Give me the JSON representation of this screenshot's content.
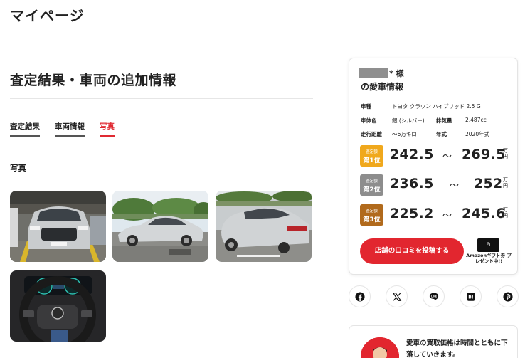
{
  "page_title": "マイページ",
  "section_title": "査定結果・車両の追加情報",
  "tabs": [
    {
      "label": "査定結果",
      "active": false
    },
    {
      "label": "車両情報",
      "active": false
    },
    {
      "label": "写真",
      "active": true
    }
  ],
  "photos_heading": "写真",
  "photos": [
    {
      "alt": "Front view of silver sedan"
    },
    {
      "alt": "Side view of silver sedan"
    },
    {
      "alt": "Rear view of silver sedan"
    },
    {
      "alt": "Steering wheel and dashboard"
    }
  ],
  "car_card": {
    "owner_suffix": "* 様",
    "heading": "の愛車情報",
    "specs": {
      "model_label": "車種",
      "model_value": "トヨタ クラウン ハイブリッド 2.5 G",
      "color_label": "車体色",
      "color_value": "銀 (シルバー)",
      "displacement_label": "排気量",
      "displacement_value": "2,487cc",
      "mileage_label": "走行距離",
      "mileage_value": "～6万キロ",
      "year_label": "年式",
      "year_value": "2020年式"
    },
    "prices": [
      {
        "badge_sub": "査定額",
        "badge_main": "第1位",
        "low": "242.5",
        "high": "269.5",
        "tilde": "～",
        "unit": "万円",
        "color": "#f0a81c"
      },
      {
        "badge_sub": "査定額",
        "badge_main": "第2位",
        "low": "236.5",
        "high": "252",
        "tilde": "～",
        "unit": "万円",
        "color": "#8d8d8d"
      },
      {
        "badge_sub": "査定額",
        "badge_main": "第3位",
        "low": "225.2",
        "high": "245.6",
        "tilde": "～",
        "unit": "万円",
        "color": "#b16a1c"
      }
    ],
    "review_button": "店舗の口コミを投稿する",
    "amazon_logo": "a",
    "amazon_text": "Amazonギフト券 プレゼント中!!"
  },
  "share_icons": [
    "facebook-icon",
    "x-icon",
    "line-icon",
    "hatena-bookmark-icon",
    "pinterest-icon"
  ],
  "share_labels": {
    "line": "LINE",
    "hatena": "B!"
  },
  "promo_text": "愛車の買取価格は時間とともに下落していきます。",
  "colors": {
    "accent": "#e2262f",
    "gold": "#f0a81c",
    "silver": "#8d8d8d",
    "bronze": "#b16a1c"
  }
}
